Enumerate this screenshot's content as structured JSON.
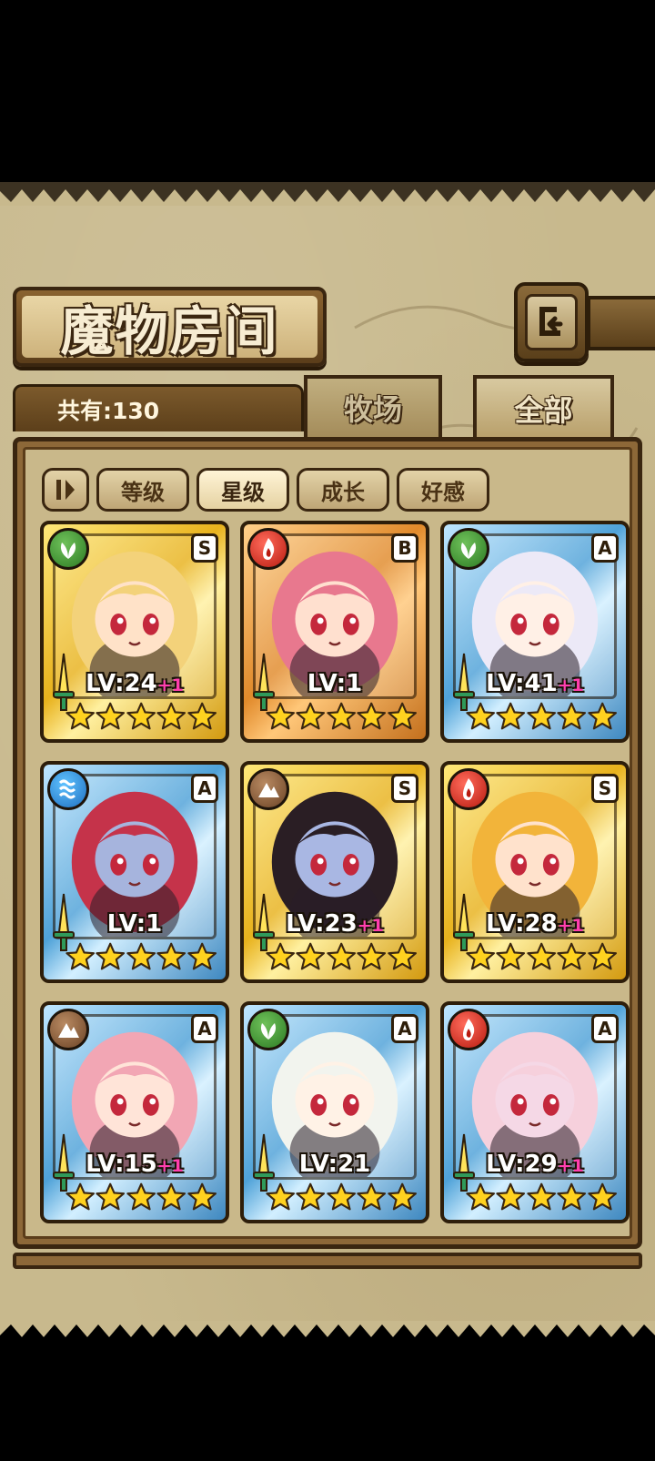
{
  "title": "魔物房间",
  "count_label": "共有:130",
  "tabs": [
    {
      "label": "牧场",
      "active": false
    },
    {
      "label": "全部",
      "active": true
    }
  ],
  "filters": [
    {
      "label": "等级",
      "active": false
    },
    {
      "label": "星级",
      "active": true
    },
    {
      "label": "成长",
      "active": false
    },
    {
      "label": "好感",
      "active": false
    }
  ],
  "cards": [
    {
      "element": "leaf",
      "rank": "S",
      "frame": "gold",
      "level": "LV:24",
      "bonus": "+1",
      "stars": 5,
      "hair": "#f3d27a",
      "skin": "#ffe2c8"
    },
    {
      "element": "fire",
      "rank": "B",
      "frame": "bronze",
      "level": "LV:1",
      "bonus": "",
      "stars": 5,
      "hair": "#e8788e",
      "skin": "#ffe0cf"
    },
    {
      "element": "leaf",
      "rank": "A",
      "frame": "blue",
      "level": "LV:41",
      "bonus": "+1",
      "stars": 5,
      "hair": "#ece9f7",
      "skin": "#fff0e6"
    },
    {
      "element": "water",
      "rank": "A",
      "frame": "blue",
      "level": "LV:1",
      "bonus": "",
      "stars": 5,
      "hair": "#c5334a",
      "skin": "#a6b4dd"
    },
    {
      "element": "earth",
      "rank": "S",
      "frame": "gold",
      "level": "LV:23",
      "bonus": "+1",
      "stars": 5,
      "hair": "#2a1e24",
      "skin": "#a9b7e3"
    },
    {
      "element": "fire",
      "rank": "S",
      "frame": "gold",
      "level": "LV:28",
      "bonus": "+1",
      "stars": 5,
      "hair": "#f2b43a",
      "skin": "#ffe2cc"
    },
    {
      "element": "earth",
      "rank": "A",
      "frame": "blue",
      "level": "LV:15",
      "bonus": "+1",
      "stars": 5,
      "hair": "#f2a6b4",
      "skin": "#ffe4d8"
    },
    {
      "element": "leaf",
      "rank": "A",
      "frame": "blue",
      "level": "LV:21",
      "bonus": "",
      "stars": 5,
      "hair": "#f2f4ee",
      "skin": "#fff2e6"
    },
    {
      "element": "fire",
      "rank": "A",
      "frame": "blue",
      "level": "LV:29",
      "bonus": "+1",
      "stars": 5,
      "hair": "#f6d0dc",
      "skin": "#f5d8e6"
    }
  ],
  "colors": {
    "parchment": "#c8b98d",
    "wood_dark": "#3a2610",
    "wood": "#8d6838",
    "star": "#ffd21f",
    "bonus": "#ff3fae"
  }
}
